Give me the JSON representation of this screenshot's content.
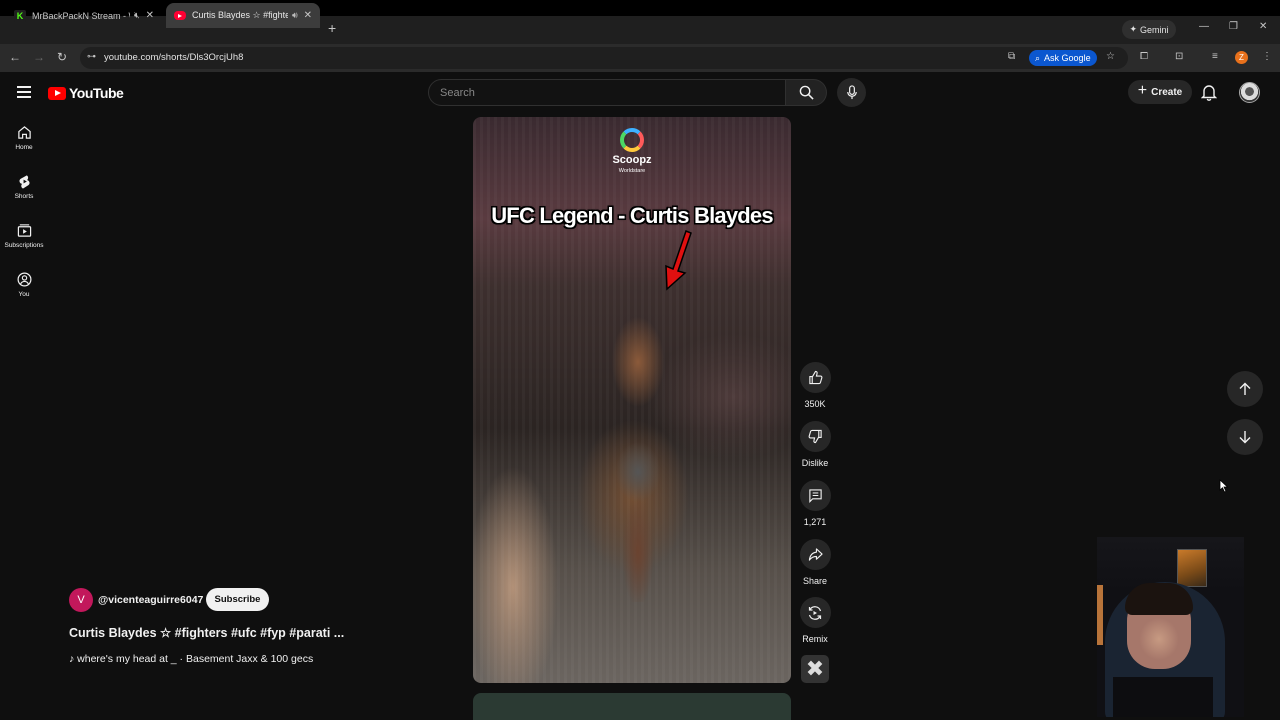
{
  "browser": {
    "tabs": [
      {
        "title": "MrBackPackN Stream - Wa",
        "favicon": "kick-logo"
      },
      {
        "title": "Curtis Blaydes ☆ #fighters",
        "favicon": "youtube-logo",
        "active": true
      }
    ],
    "gemini_label": "Gemini",
    "url": "youtube.com/shorts/Dls3OrcjUh8",
    "ask_google_label": "Ask Google",
    "profile_initial": "Z"
  },
  "masthead": {
    "logo_text": "YouTube",
    "search_placeholder": "Search",
    "create_label": "Create"
  },
  "sidebar": {
    "items": [
      {
        "label": "Home",
        "icon": "home-icon"
      },
      {
        "label": "Shorts",
        "icon": "shorts-icon"
      },
      {
        "label": "Subscriptions",
        "icon": "subscriptions-icon"
      },
      {
        "label": "You",
        "icon": "you-icon"
      }
    ]
  },
  "video": {
    "watermark_name": "Scoopz",
    "watermark_sub": "Worldstare",
    "overlay_text": "UFC Legend - Curtis Blaydes"
  },
  "actions": {
    "like_count": "350K",
    "dislike_label": "Dislike",
    "comment_count": "1,271",
    "share_label": "Share",
    "remix_label": "Remix"
  },
  "meta": {
    "channel_initial": "V",
    "channel": "@vicenteaguirre6047",
    "subscribe_label": "Subscribe",
    "title": "Curtis Blaydes ☆ #fighters #ufc #fyp #parati ...",
    "music": "where's my head at _ · Basement Jaxx & 100 gecs"
  },
  "colors": {
    "background": "#0f0f0f",
    "brand_red": "#ff0000",
    "ask_google_blue": "#0b57d0"
  }
}
